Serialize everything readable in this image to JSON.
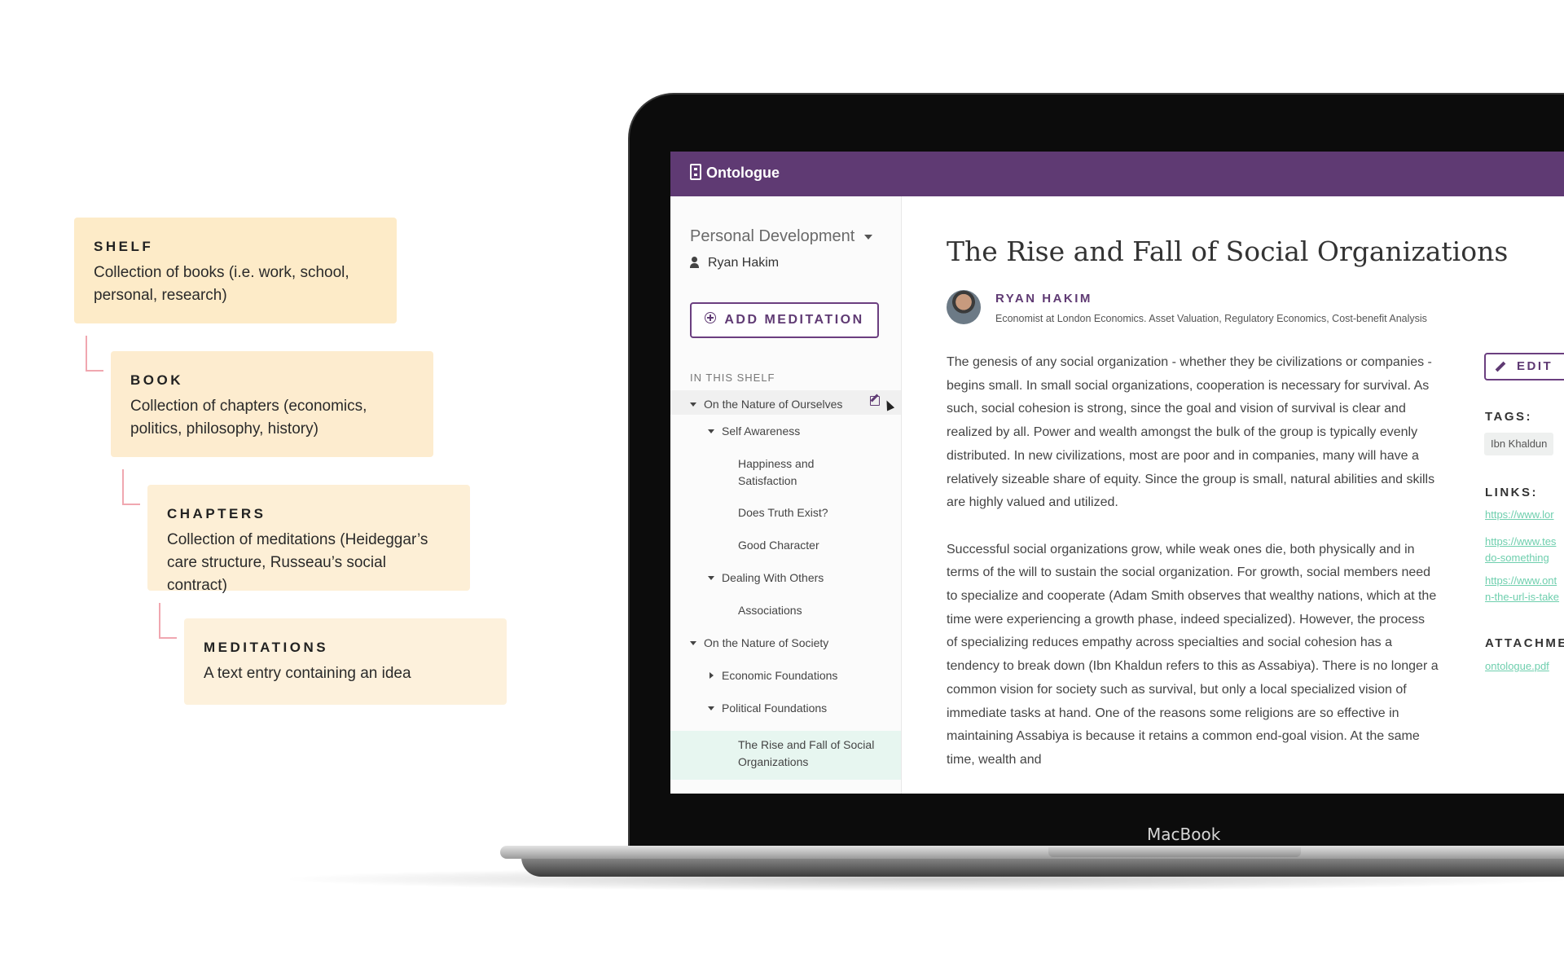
{
  "hierarchy": [
    {
      "title": "SHELF",
      "description": "Collection of books (i.e. work, school, personal, research)"
    },
    {
      "title": "BOOK",
      "description": "Collection of chapters (economics, politics, philosophy, history)"
    },
    {
      "title": "CHAPTERS",
      "description": "Collection of meditations (Heideggar’s care structure, Russeau’s social contract)"
    },
    {
      "title": "MEDITATIONS",
      "description": "A text entry containing an idea"
    }
  ],
  "laptop": {
    "label": "MacBook"
  },
  "app": {
    "name": "Ontologue"
  },
  "sidebar": {
    "shelf_name": "Personal Development",
    "owner": "Ryan Hakim",
    "add_button": "ADD MEDITATION",
    "section_label": "IN THIS SHELF",
    "tree": [
      {
        "label": "On the Nature of Ourselves"
      },
      {
        "label": "Self Awareness"
      },
      {
        "label": "Happiness and Satisfaction"
      },
      {
        "label": "Does Truth Exist?"
      },
      {
        "label": "Good Character"
      },
      {
        "label": "Dealing With Others"
      },
      {
        "label": "Associations"
      },
      {
        "label": "On the Nature of Society"
      },
      {
        "label": "Economic Foundations"
      },
      {
        "label": "Political Foundations"
      },
      {
        "label": "The Rise and Fall of Social Organizations"
      }
    ]
  },
  "article": {
    "title": "The Rise and Fall of Social Organizations",
    "author": "RYAN HAKIM",
    "author_desc": "Economist at London Economics. Asset Valuation, Regulatory Economics, Cost-benefit Analysis",
    "paragraphs": [
      "The genesis of any social organization - whether they be civilizations or companies - begins small. In small social organizations, cooperation is necessary for survival. As such, social cohesion is strong, since the goal and vision of survival is clear and realized by all. Power and wealth amongst the bulk of the group is typically evenly distributed. In new civilizations, most are poor and in companies, many will have a relatively sizeable share of equity. Since the group is small, natural abilities and skills are highly valued and utilized.",
      "Successful social organizations grow, while weak ones die, both physically and in terms of the will to sustain the social organization. For growth, social members need to specialize and cooperate (Adam Smith observes that wealthy nations, which at the time were experiencing a growth phase, indeed specialized). However, the process of specializing reduces empathy across specialties and social cohesion has a tendency to break down (Ibn Khaldun refers to this as Assabiya). There is no longer a common vision for society such as survival, but only a local specialized vision of immediate tasks at hand. One of the reasons some religions are so effective in maintaining Assabiya is because it retains a common end-goal vision. At the same time, wealth and"
    ]
  },
  "details": {
    "edit_button": "EDIT",
    "tags_label": "TAGS:",
    "tags": [
      "Ibn Khaldun"
    ],
    "links_label": "LINKS:",
    "links": [
      {
        "line1": "https://www.lor",
        "line2": ""
      },
      {
        "line1": "https://www.tes",
        "line2": "do-something"
      },
      {
        "line1": "https://www.ont",
        "line2": "n-the-url-is-take"
      }
    ],
    "attachments_label": "ATTACHME",
    "attachments": [
      "ontologue.pdf"
    ]
  },
  "colors": {
    "brand_purple": "#5f3a73",
    "link_green": "#6fcfae",
    "card_bg": "#fdebc8",
    "connector_pink": "#f0a7b0",
    "active_row": "#e7f6f0"
  }
}
